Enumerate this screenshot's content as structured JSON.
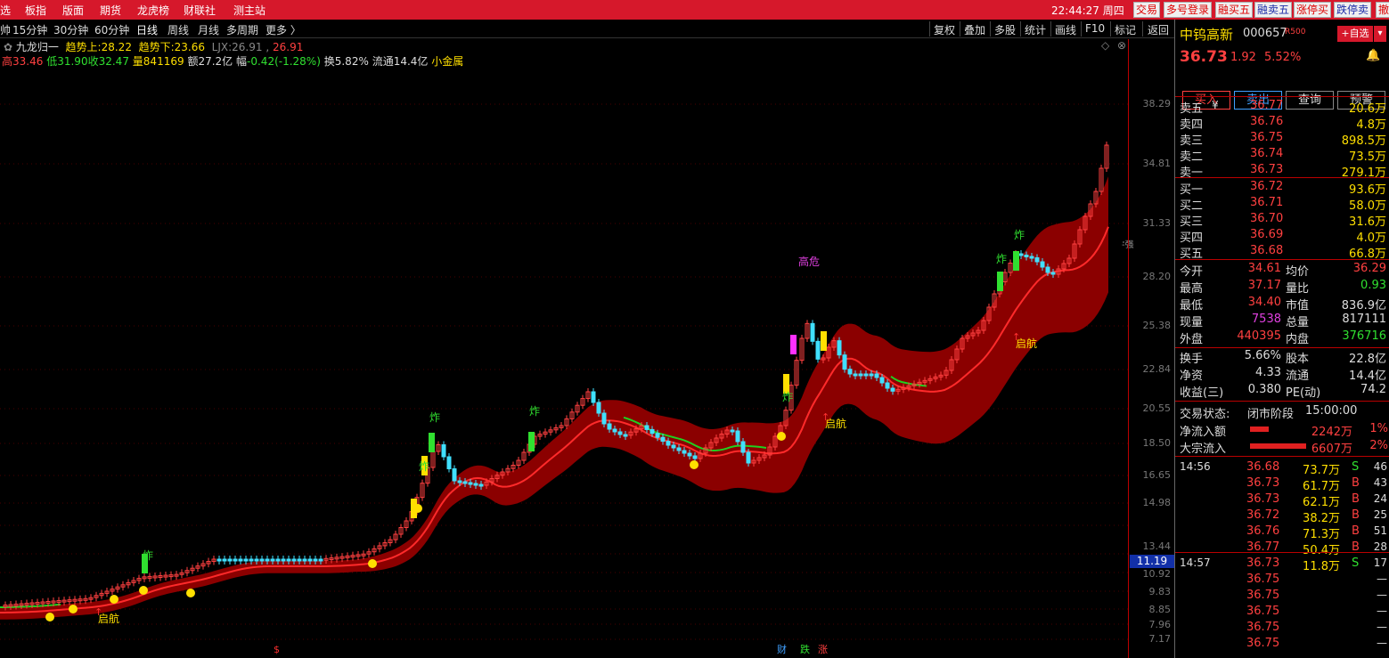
{
  "topbar": {
    "menus": [
      "选",
      "板指",
      "版面",
      "期货",
      "龙虎榜",
      "财联社",
      "测主站"
    ],
    "clock": "22:44:27 周四",
    "buttons": [
      "交易",
      "多号登录",
      "融买五",
      "融卖五",
      "涨停买",
      "跌停卖",
      "撤"
    ]
  },
  "toolbar": {
    "periods": [
      "帅",
      "15分钟",
      "30分钟",
      "60分钟",
      "日线",
      "周线",
      "月线",
      "多周期",
      "更多 〉"
    ],
    "right": [
      "复权",
      "叠加",
      "多股",
      "统计",
      "画线",
      "F10",
      "标记",
      "返回"
    ]
  },
  "info": {
    "indicator": "九龙归一",
    "trend_up_label": "趋势上:",
    "trend_up": "28.22",
    "trend_down_label": "趋势下:",
    "trend_down": "23.66",
    "ljx_label": "LJX:",
    "ljx1": "26.91",
    "ljx2": "26.91",
    "high_label": "高",
    "high": "33.46",
    "low_label": "低",
    "low": "31.90",
    "close_label": "收",
    "close": "32.47",
    "vol_label": "量",
    "vol": "841169",
    "amt_label": "额",
    "amt": "27.2亿",
    "chg_label": "幅",
    "chg": "-0.42(-1.28%)",
    "turnover": "换5.82%",
    "float": "流通14.4亿",
    "sector": "小金属"
  },
  "axis": [
    "38.29",
    "34.81",
    "31.33",
    "28.20",
    "25.38",
    "22.84",
    "20.55",
    "18.50",
    "16.65",
    "14.98",
    "13.44",
    "10.92",
    "9.83",
    "8.85",
    "7.96",
    "7.17"
  ],
  "current_price_tag": "11.19",
  "side_marker": "-强",
  "chart_labels": {
    "zha": "炸",
    "qihang": "启航",
    "gaowei": "高危",
    "cai": "财",
    "die": "跌",
    "zhang": "涨",
    "dollar": "$"
  },
  "stock": {
    "name": "中钨高新",
    "code": "000657",
    "tag": "R500",
    "add_btn": "+自选",
    "price": "36.73",
    "change": "1.92",
    "pct": "5.52%"
  },
  "actions": [
    "买入",
    "卖出",
    "查询",
    "预警"
  ],
  "asks": [
    {
      "label": "卖五",
      "price": "36.77",
      "vol": "20.6万"
    },
    {
      "label": "卖四",
      "price": "36.76",
      "vol": "4.8万"
    },
    {
      "label": "卖三",
      "price": "36.75",
      "vol": "898.5万"
    },
    {
      "label": "卖二",
      "price": "36.74",
      "vol": "73.5万"
    },
    {
      "label": "卖一",
      "price": "36.73",
      "vol": "279.1万"
    }
  ],
  "ask_unit": "¥",
  "bids": [
    {
      "label": "买一",
      "price": "36.72",
      "vol": "93.6万"
    },
    {
      "label": "买二",
      "price": "36.71",
      "vol": "58.0万"
    },
    {
      "label": "买三",
      "price": "36.70",
      "vol": "31.6万"
    },
    {
      "label": "买四",
      "price": "36.69",
      "vol": "4.0万"
    },
    {
      "label": "买五",
      "price": "36.68",
      "vol": "66.8万"
    }
  ],
  "stats": [
    {
      "l1": "今开",
      "v1": "34.61",
      "c1": "#ff4040",
      "l2": "均价",
      "v2": "36.29",
      "c2": "#ff4040"
    },
    {
      "l1": "最高",
      "v1": "37.17",
      "c1": "#ff4040",
      "l2": "量比",
      "v2": "0.93",
      "c2": "#30e030"
    },
    {
      "l1": "最低",
      "v1": "34.40",
      "c1": "#ff4040",
      "l2": "市值",
      "v2": "836.9亿",
      "c2": "#ddd"
    },
    {
      "l1": "现量",
      "v1": "7538",
      "c1": "#e040e0",
      "l2": "总量",
      "v2": "817111",
      "c2": "#ddd"
    },
    {
      "l1": "外盘",
      "v1": "440395",
      "c1": "#ff4040",
      "l2": "内盘",
      "v2": "376716",
      "c2": "#30e030"
    }
  ],
  "fund": [
    {
      "l1": "换手",
      "v1": "5.66%",
      "l2": "股本",
      "v2": "22.8亿"
    },
    {
      "l1": "净资",
      "v1": "4.33",
      "l2": "流通",
      "v2": "14.4亿"
    },
    {
      "l1": "收益(三)",
      "v1": "0.380",
      "l2": "PE(动)",
      "v2": "74.2"
    }
  ],
  "trade_state": {
    "label": "交易状态:",
    "stage": "闭市阶段",
    "time": "15:00:00"
  },
  "flows": [
    {
      "label": "净流入额",
      "value": "2242万",
      "pct": "1%",
      "bar": 0.3
    },
    {
      "label": "大宗流入",
      "value": "6607万",
      "pct": "2%",
      "bar": 0.9
    }
  ],
  "ticks": [
    {
      "time": "14:56",
      "price": "36.68",
      "vol": "73.7万",
      "side": "S",
      "n": "46"
    },
    {
      "time": "",
      "price": "36.73",
      "vol": "61.7万",
      "side": "B",
      "n": "43"
    },
    {
      "time": "",
      "price": "36.73",
      "vol": "62.1万",
      "side": "B",
      "n": "24"
    },
    {
      "time": "",
      "price": "36.72",
      "vol": "38.2万",
      "side": "B",
      "n": "25"
    },
    {
      "time": "",
      "price": "36.76",
      "vol": "71.3万",
      "side": "B",
      "n": "51"
    },
    {
      "time": "",
      "price": "36.77",
      "vol": "50.4万",
      "side": "B",
      "n": "28"
    },
    {
      "time": "14:57",
      "price": "36.73",
      "vol": "11.8万",
      "side": "S",
      "n": "17"
    },
    {
      "time": "",
      "price": "36.75",
      "vol": "",
      "side": "",
      "n": "—"
    },
    {
      "time": "",
      "price": "36.75",
      "vol": "",
      "side": "",
      "n": "—"
    },
    {
      "time": "",
      "price": "36.75",
      "vol": "",
      "side": "",
      "n": "—"
    },
    {
      "time": "",
      "price": "36.75",
      "vol": "",
      "side": "",
      "n": "—"
    },
    {
      "time": "",
      "price": "36.75",
      "vol": "",
      "side": "",
      "n": "—"
    }
  ],
  "colors": {
    "up": "#ff4040",
    "down": "#40e0ff",
    "band": "#8b0000",
    "line": "#ff2020",
    "signal": "#ffdf00"
  }
}
